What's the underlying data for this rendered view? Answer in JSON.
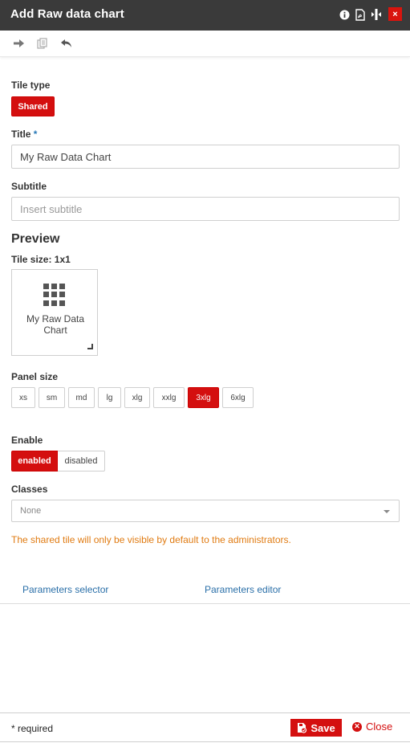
{
  "window": {
    "title": "Add Raw data chart",
    "icons": [
      "info-icon",
      "pdf-icon",
      "resize-width-icon",
      "close-icon"
    ],
    "close_label": "×"
  },
  "toolbar": {
    "icons": [
      "arrow-right-icon",
      "copy-icon",
      "undo-icon"
    ]
  },
  "tile_type": {
    "label": "Tile type",
    "value": "Shared"
  },
  "title_field": {
    "label": "Title",
    "required_mark": "*",
    "value": "My Raw Data Chart",
    "placeholder": ""
  },
  "subtitle_field": {
    "label": "Subtitle",
    "value": "",
    "placeholder": "Insert subtitle"
  },
  "preview": {
    "heading": "Preview",
    "tile_size_label": "Tile size: 1x1",
    "tile_text": "My Raw Data Chart",
    "tile_icon": "grid-icon"
  },
  "panel_size": {
    "label": "Panel size",
    "options": [
      "xs",
      "sm",
      "md",
      "lg",
      "xlg",
      "xxlg",
      "3xlg",
      "6xlg"
    ],
    "selected": "3xlg"
  },
  "enable": {
    "label": "Enable",
    "on_label": "enabled",
    "off_label": "disabled",
    "selected": "enabled"
  },
  "classes": {
    "label": "Classes",
    "value": "None"
  },
  "notice": "The shared tile will only be visible by default to the administrators.",
  "tabs": {
    "parameters_selector": "Parameters selector",
    "parameters_editor": "Parameters editor"
  },
  "footer": {
    "required_note": "* required",
    "save_label": "Save",
    "close_label": "Close"
  },
  "colors": {
    "titlebar": "#3a3a3a",
    "accent_red": "#d40f0f",
    "link_blue": "#2a6fa8",
    "notice_orange": "#e07b12"
  }
}
